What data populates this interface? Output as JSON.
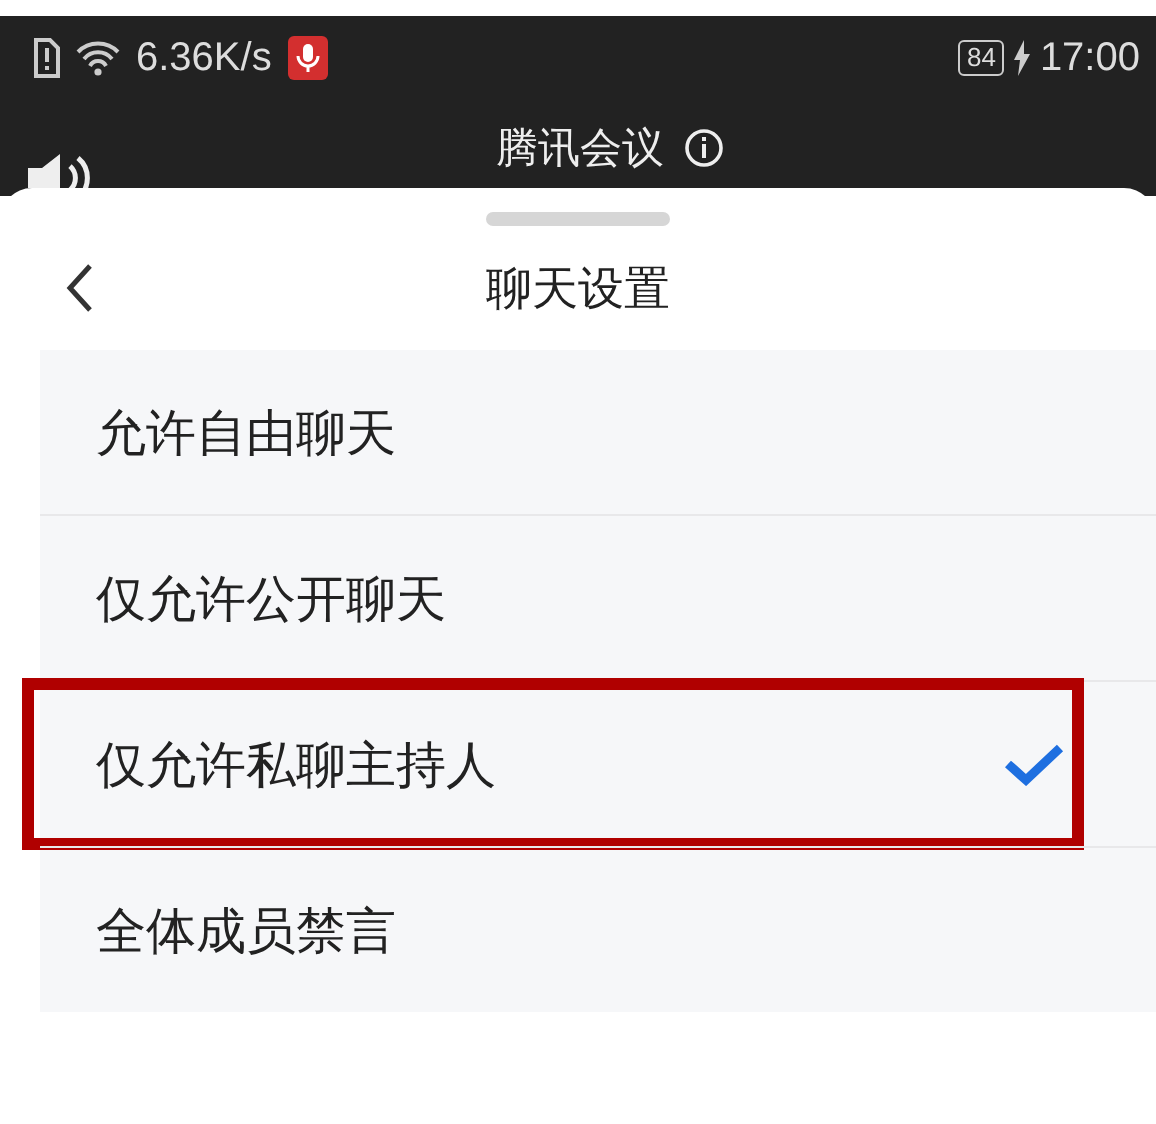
{
  "status_bar": {
    "network_speed": "6.36K/s",
    "battery": "84",
    "time": "17:00"
  },
  "meeting_bar": {
    "title": "腾讯会议"
  },
  "sheet": {
    "title": "聊天设置",
    "options": [
      {
        "label": "允许自由聊天",
        "selected": false,
        "highlighted": false
      },
      {
        "label": "仅允许公开聊天",
        "selected": false,
        "highlighted": false
      },
      {
        "label": "仅允许私聊主持人",
        "selected": true,
        "highlighted": true
      },
      {
        "label": "全体成员禁言",
        "selected": false,
        "highlighted": false
      }
    ]
  }
}
